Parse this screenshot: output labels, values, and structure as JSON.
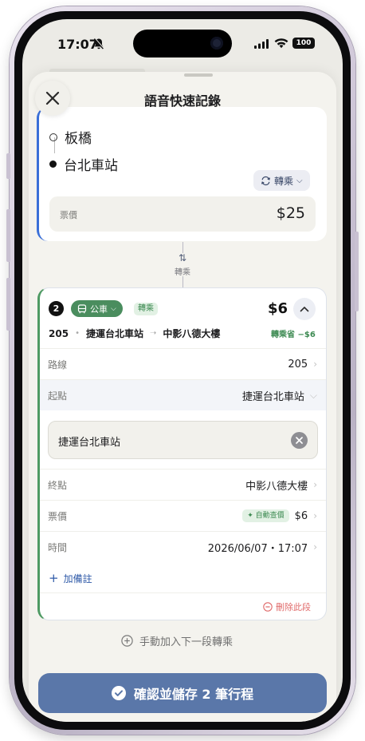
{
  "status_bar": {
    "time": "17:07",
    "battery": "100"
  },
  "sheet": {
    "title": "語音快速記錄"
  },
  "segment1": {
    "from": "板橋",
    "to": "台北車站",
    "transfer_label": "轉乘",
    "fare_label": "票價",
    "fare_value": "$25"
  },
  "connector": {
    "label": "轉乘"
  },
  "segment2": {
    "number": "2",
    "mode": "公車",
    "transfer_tag": "轉乘",
    "price": "$6",
    "route_no": "205",
    "route_from": "捷運台北車站",
    "route_to": "中影八德大樓",
    "saving": "轉乘省 −$6",
    "fields": {
      "route": {
        "label": "路線",
        "value": "205"
      },
      "start": {
        "label": "起點",
        "value": "捷運台北車站"
      },
      "start_input_value": "捷運台北車站",
      "end": {
        "label": "終點",
        "value": "中影八德大樓"
      },
      "fare": {
        "label": "票價",
        "auto_tag": "自動查價",
        "value": "$6"
      },
      "time": {
        "label": "時間",
        "value": "2026/06/07・17:07"
      }
    },
    "add_note": "加備註",
    "delete": "刪除此段"
  },
  "manual_add": "手動加入下一段轉乘",
  "confirm_button": "確認並儲存 2 筆行程",
  "colors": {
    "accent_blue": "#3a6fd8",
    "accent_green": "#4e9a63",
    "confirm": "#5a77a9",
    "danger": "#e06a6a"
  }
}
